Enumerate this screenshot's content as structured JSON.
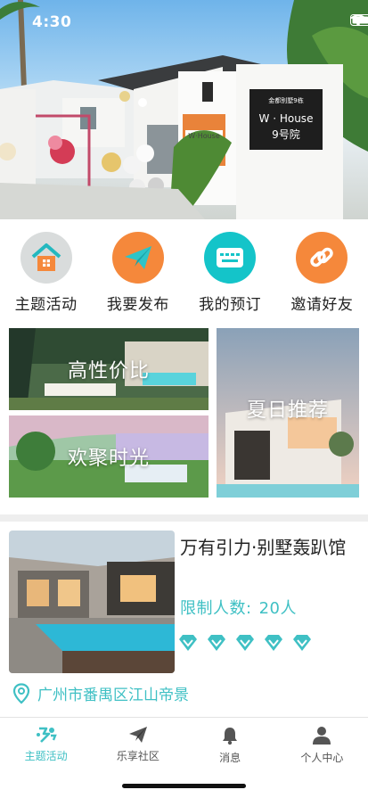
{
  "status_bar": {
    "time": "4:30"
  },
  "hero": {
    "sign_small": "金都别墅9栋",
    "sign_brand": "W · House",
    "sign_number": "9号院",
    "tag": "W·House"
  },
  "actions": [
    {
      "label": "主题活动",
      "icon": "house-icon",
      "color": "#d9dcdc"
    },
    {
      "label": "我要发布",
      "icon": "paper-plane-icon",
      "color": "#f5883b"
    },
    {
      "label": "我的预订",
      "icon": "ticket-icon",
      "color": "#14c4c9"
    },
    {
      "label": "邀请好友",
      "icon": "link-icon",
      "color": "#f5883b"
    }
  ],
  "tiles": {
    "value": "高性价比",
    "gathering": "欢聚时光",
    "summer": "夏日推荐"
  },
  "event": {
    "title": "万有引力·别墅轰趴馆",
    "limit_label": "限制人数:",
    "limit_value": "20人",
    "rating": 5,
    "location": "广州市番禺区江山帝景"
  },
  "tabs": [
    {
      "label": "主题活动",
      "icon": "activity-icon",
      "active": true
    },
    {
      "label": "乐享社区",
      "icon": "paper-plane-icon",
      "active": false
    },
    {
      "label": "消息",
      "icon": "bell-icon",
      "active": false
    },
    {
      "label": "个人中心",
      "icon": "person-icon",
      "active": false
    }
  ],
  "colors": {
    "accent": "#3fc0c4",
    "orange": "#f5883b",
    "teal": "#14c4c9"
  }
}
